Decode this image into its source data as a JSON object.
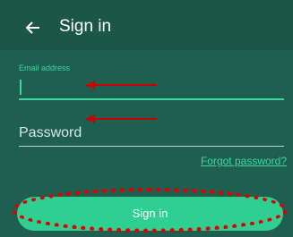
{
  "header": {
    "back_icon": "arrow-left-icon",
    "title": "Sign in"
  },
  "email": {
    "label": "Email address",
    "value": ""
  },
  "password": {
    "placeholder": "Password",
    "value": ""
  },
  "forgot_link": "Forgot password?",
  "signin_button": "Sign in",
  "annotations": {
    "arrow_color": "#cc0000",
    "highlight_color": "#e00000"
  },
  "colors": {
    "background": "#1e5f4f",
    "accent": "#3dd6a0",
    "button": "#2fcf91"
  }
}
